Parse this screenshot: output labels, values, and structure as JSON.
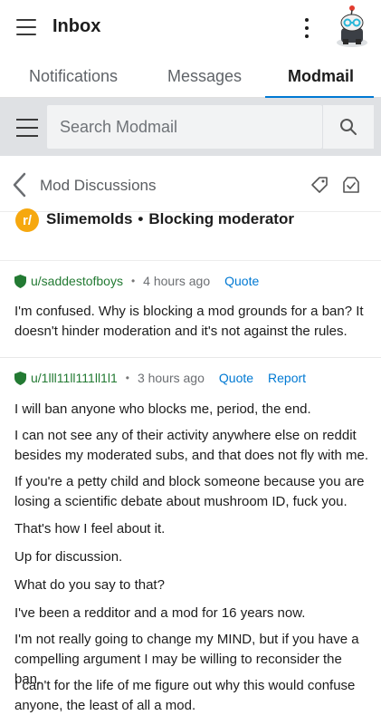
{
  "appbar": {
    "title": "Inbox"
  },
  "tabs": [
    {
      "label": "Notifications",
      "active": false
    },
    {
      "label": "Messages",
      "active": false
    },
    {
      "label": "Modmail",
      "active": true
    }
  ],
  "colors": {
    "accent": "#0079d3",
    "mod_green": "#237a33",
    "subreddit_orange": "#f6a80f"
  },
  "search": {
    "placeholder": "Search Modmail"
  },
  "discussion": {
    "back_title": "Mod Discussions"
  },
  "subject": {
    "subreddit_icon": "r/",
    "subreddit": "Slimemolds",
    "separator": "•",
    "title": "Blocking moderator"
  },
  "messages": [
    {
      "author": "u/saddestofboys",
      "separator": "•",
      "time": "4 hours ago",
      "actions": [
        "Quote"
      ],
      "paragraphs": [
        "I'm confused. Why is blocking a mod grounds for a ban? It doesn't hinder moderation and it's not against the rules."
      ]
    },
    {
      "author": "u/1lll11ll111ll1l1",
      "separator": "•",
      "time": "3 hours ago",
      "actions": [
        "Quote",
        "Report"
      ],
      "paragraphs": [
        "I will ban anyone who blocks me, period, the end.",
        "I can not see any of their activity anywhere else on reddit besides my moderated subs, and that does not fly with me.",
        "If you're a petty child and block someone because you are losing a scientific debate about mushroom ID, fuck you.",
        "That's how I feel about it.",
        "Up for discussion.",
        "What do you say to that?",
        "I've been a redditor and a mod for 16 years now.",
        "I'm not really going to change my MIND, but if you have a compelling argument I may be willing to reconsider the ban.",
        "I can't for the life of me figure out why this would confuse anyone, the least of all a mod."
      ]
    }
  ]
}
